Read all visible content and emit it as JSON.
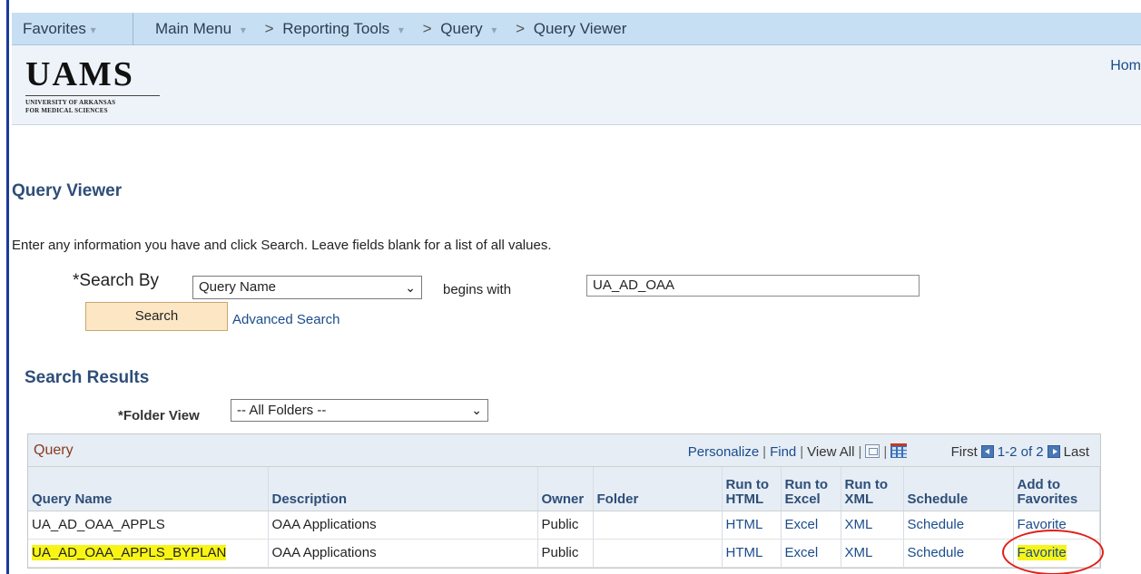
{
  "nav": {
    "favorites": "Favorites",
    "main_menu": "Main Menu",
    "sep": ">",
    "breadcrumb": [
      "Reporting Tools",
      "Query",
      "Query Viewer"
    ]
  },
  "header": {
    "logo_word": "UAMS",
    "logo_sub_1": "UNIVERSITY OF ARKANSAS",
    "logo_sub_2": "FOR MEDICAL SCIENCES",
    "home_link": "Hom"
  },
  "page": {
    "title": "Query Viewer",
    "instructions": "Enter any information you have and click Search. Leave fields blank for a list of all values."
  },
  "search": {
    "label": "*Search By",
    "field_value": "Query Name",
    "operator": "begins with",
    "input_value": "UA_AD_OAA",
    "button": "Search",
    "advanced": "Advanced Search"
  },
  "results": {
    "title": "Search Results",
    "folder_label": "*Folder View",
    "folder_value": "-- All Folders --",
    "grid_title": "Query",
    "tools": {
      "personalize": "Personalize",
      "find": "Find",
      "view_all": "View All",
      "first": "First",
      "range": "1-2 of 2",
      "last": "Last",
      "sep": "|"
    },
    "columns": [
      "Query Name",
      "Description",
      "Owner",
      "Folder",
      "Run to HTML",
      "Run to Excel",
      "Run to XML",
      "Schedule",
      "Add to Favorites"
    ],
    "rows": [
      {
        "name": "UA_AD_OAA_APPLS",
        "description": "OAA Applications",
        "owner": "Public",
        "folder": "",
        "html": "HTML",
        "excel": "Excel",
        "xml": "XML",
        "schedule": "Schedule",
        "favorite": "Favorite"
      },
      {
        "name": "UA_AD_OAA_APPLS_BYPLAN",
        "description": "OAA Applications",
        "owner": "Public",
        "folder": "",
        "html": "HTML",
        "excel": "Excel",
        "xml": "XML",
        "schedule": "Schedule",
        "favorite": "Favorite"
      }
    ]
  },
  "colors": {
    "nav_bg": "#c7dff3",
    "title_blue": "#2e4e78",
    "link_blue": "#1a4c8c",
    "highlight": "#f8f516",
    "annotation_red": "#e0201a",
    "button_bg": "#fce6c4"
  },
  "icons": [
    "chevron-down-icon",
    "popout-icon",
    "grid-download-icon",
    "previous-arrow-icon",
    "next-arrow-icon"
  ]
}
